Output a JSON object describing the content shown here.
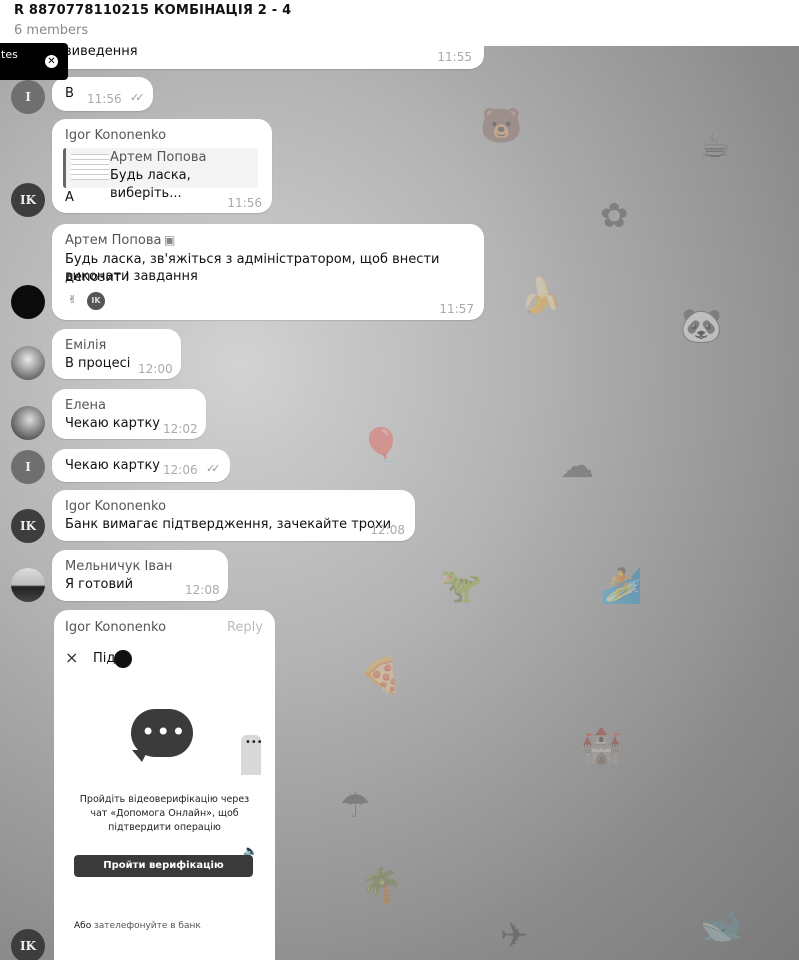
{
  "header": {
    "title": "R 8870778110215 КОМБІНАЦІЯ 2 - 4",
    "members": "6 members"
  },
  "toast": {
    "text": "tes"
  },
  "messages": [
    {
      "text": "виведення",
      "time": "11:55"
    },
    {
      "avatar": "I",
      "text": "В",
      "time": "11:56"
    },
    {
      "avatar": "IK",
      "sender": "Igor Kononenko",
      "reply_name": "Артем Попова",
      "reply_text": "Будь ласка, виберіть...",
      "text": "А",
      "time": "11:56"
    },
    {
      "sender": "Артем Попова",
      "text1": "Будь ласка, зв'яжіться з адміністратором, щоб внести депозит і",
      "text2": "виконати завдання",
      "reaction_avatar": "IK",
      "time": "11:57"
    },
    {
      "sender": "Емілія",
      "text": "В процесі",
      "time": "12:00"
    },
    {
      "sender": "Елена",
      "text": "Чекаю картку",
      "time": "12:02"
    },
    {
      "avatar": "I",
      "text": "Чекаю картку",
      "time": "12:06"
    },
    {
      "avatar": "IK",
      "sender": "Igor Kononenko",
      "text": "Банк вимагає підтвердження, зачекайте трохи",
      "time": "12:08"
    },
    {
      "sender": "Мельничук Іван",
      "text": "Я готовий",
      "time": "12:08"
    },
    {
      "avatar": "IK",
      "sender": "Igor Kononenko",
      "reply_label": "Reply"
    }
  ],
  "media": {
    "close": "×",
    "search_text": "Під",
    "dots": "•••",
    "prompt": "Пройдіть відеоверифікацію через чат «Допомога Онлайн», щоб підтвердити операцію",
    "button": "Пройти верифікацію",
    "alt_prefix": "Або",
    "alt_link": "зателефонуйте в банк"
  }
}
